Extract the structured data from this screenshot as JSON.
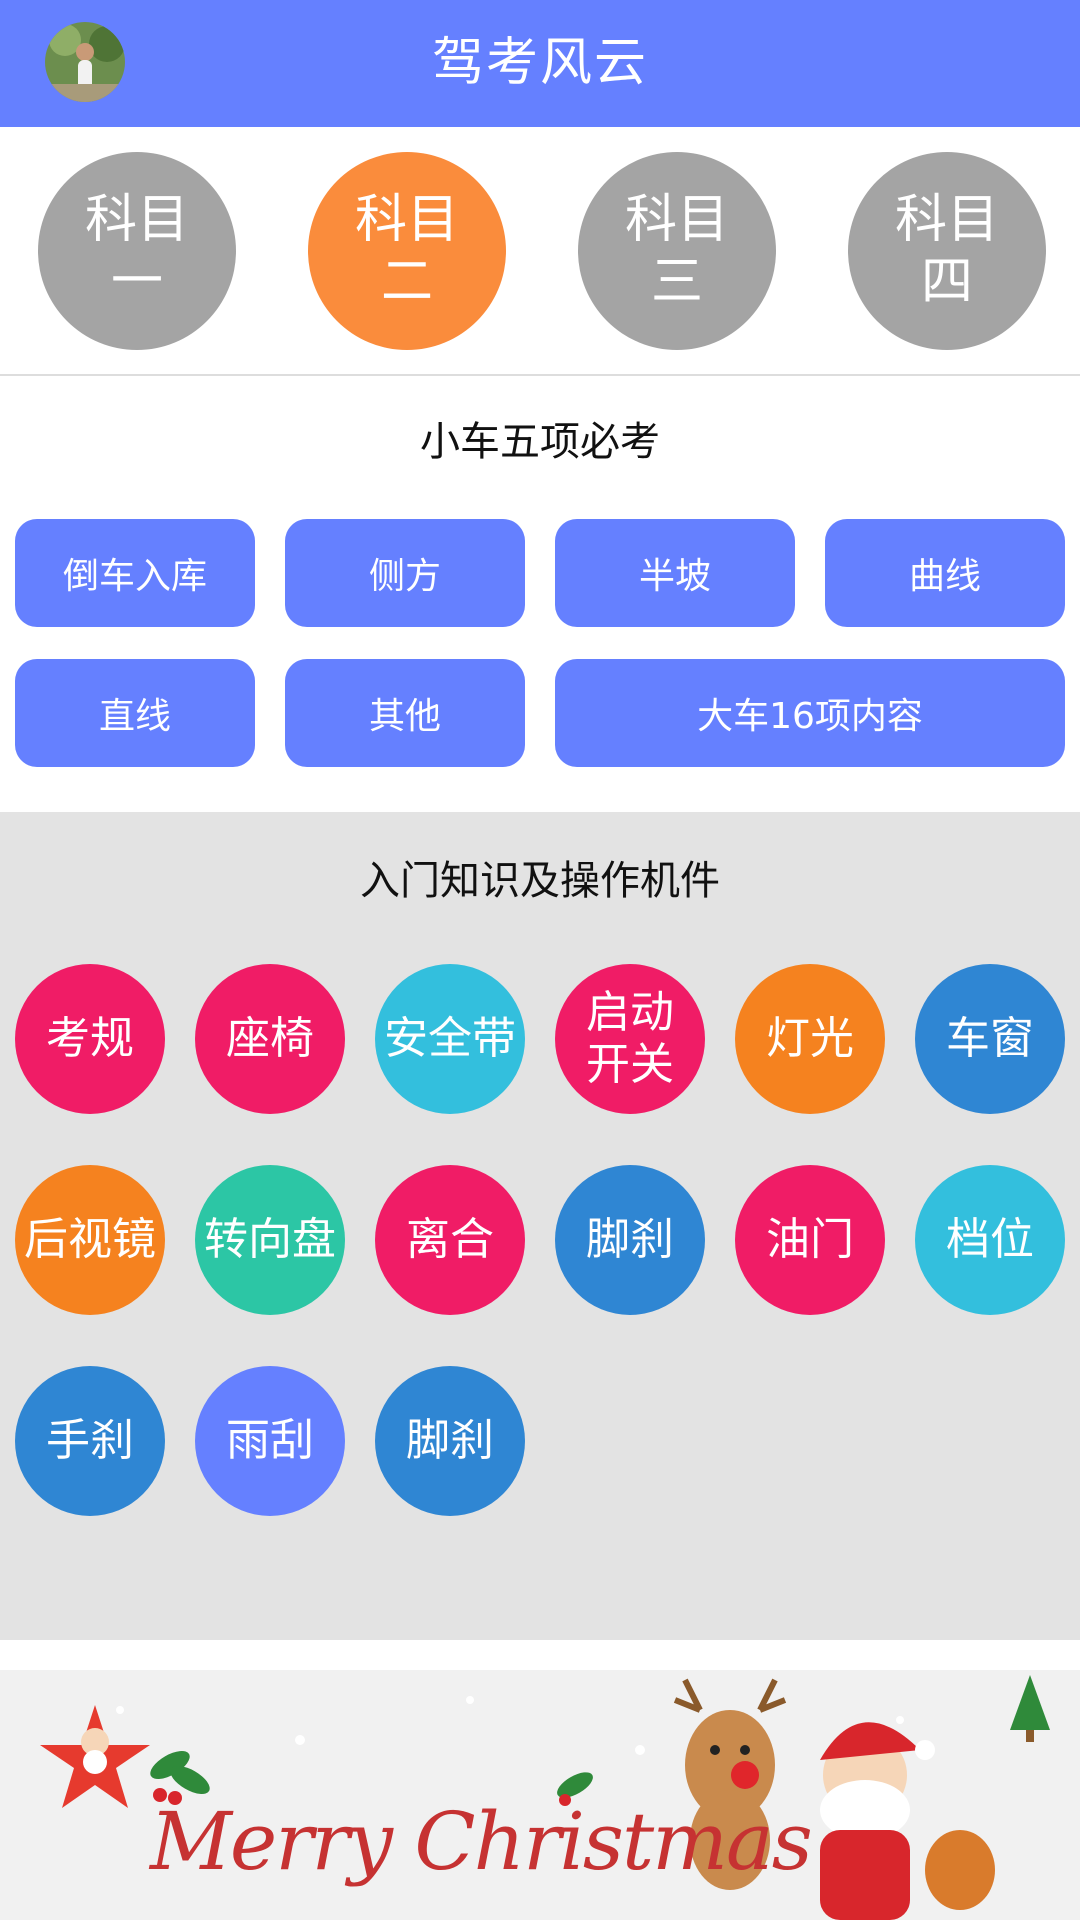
{
  "header": {
    "title": "驾考风云"
  },
  "subjects": [
    {
      "line1": "科目",
      "line2": "一",
      "active": false
    },
    {
      "line1": "科目",
      "line2": "二",
      "active": true
    },
    {
      "line1": "科目",
      "line2": "三",
      "active": false
    },
    {
      "line1": "科目",
      "line2": "四",
      "active": false
    }
  ],
  "section1": {
    "title": "小车五项必考",
    "items": [
      "倒车入库",
      "侧方",
      "半坡",
      "曲线",
      "直线",
      "其他",
      "大车16项内容"
    ]
  },
  "section2": {
    "title": "入门知识及操作机件",
    "items": [
      {
        "label": "考规",
        "color": "#f01c66"
      },
      {
        "label": "座椅",
        "color": "#f01c66"
      },
      {
        "label": "安全带",
        "color": "#33bfdd"
      },
      {
        "label": "启动\n开关",
        "color": "#f01c66"
      },
      {
        "label": "灯光",
        "color": "#f5821f"
      },
      {
        "label": "车窗",
        "color": "#2f86d3"
      },
      {
        "label": "后视镜",
        "color": "#f5821f"
      },
      {
        "label": "转向盘",
        "color": "#2cc6a5"
      },
      {
        "label": "离合",
        "color": "#f01c66"
      },
      {
        "label": "脚刹",
        "color": "#2f86d3"
      },
      {
        "label": "油门",
        "color": "#f01c66"
      },
      {
        "label": "档位",
        "color": "#33bfdd"
      },
      {
        "label": "手刹",
        "color": "#2f86d3"
      },
      {
        "label": "雨刮",
        "color": "#6580ff"
      },
      {
        "label": "脚刹",
        "color": "#2f86d3"
      }
    ]
  },
  "banner": {
    "text": "Merry Christmas"
  },
  "colors": {
    "primary": "#6580ff",
    "active_subject": "#fa8c3c",
    "inactive_subject": "#a4a4a4"
  }
}
